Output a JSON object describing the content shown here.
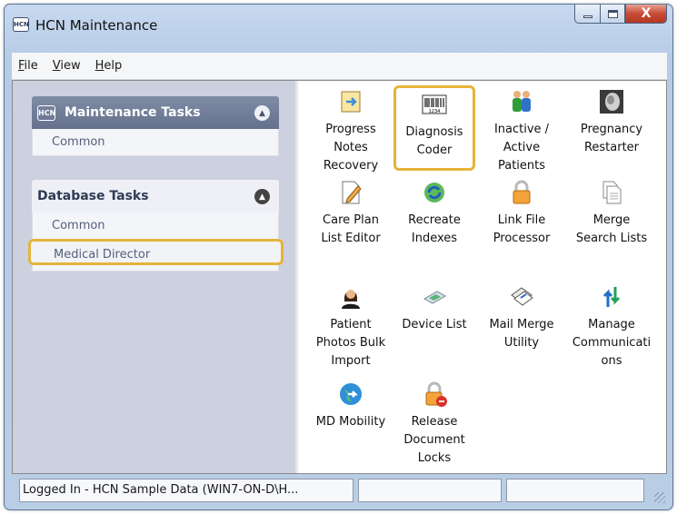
{
  "window": {
    "title": "HCN Maintenance",
    "app_icon_text": "HCN"
  },
  "caption_buttons": {
    "close_glyph": "X"
  },
  "menu": [
    {
      "label": "File",
      "accel": "F",
      "rest": "ile"
    },
    {
      "label": "View",
      "accel": "V",
      "rest": "iew"
    },
    {
      "label": "Help",
      "accel": "H",
      "rest": "elp"
    }
  ],
  "maintenance_panel": {
    "title": "Maintenance Tasks",
    "icon_text": "HCN",
    "items": [
      "Common"
    ]
  },
  "database_panel": {
    "title": "Database Tasks",
    "items": [
      "Common",
      "Medical Director"
    ],
    "highlighted_item": "Medical Director"
  },
  "tools": [
    {
      "label": "Progress Notes Recovery",
      "icon": "notes-recovery-icon",
      "lines": [
        "Progress",
        "Notes",
        "Recovery"
      ]
    },
    {
      "label": "Diagnosis Coder",
      "icon": "barcode-icon",
      "lines": [
        "Diagnosis",
        "Coder"
      ],
      "highlighted": true,
      "icon_text": "1234"
    },
    {
      "label": "Inactive / Active Patients",
      "icon": "patients-icon",
      "lines": [
        "Inactive /",
        "Active",
        "Patients"
      ]
    },
    {
      "label": "Pregnancy Restarter",
      "icon": "ultrasound-icon",
      "lines": [
        "Pregnancy",
        "Restarter"
      ]
    },
    {
      "label": "Care Plan List Editor",
      "icon": "edit-document-icon",
      "lines": [
        "Care Plan",
        "List Editor"
      ]
    },
    {
      "label": "Recreate Indexes",
      "icon": "recreate-icon",
      "lines": [
        "Recreate",
        "Indexes"
      ]
    },
    {
      "label": "Link File Processor",
      "icon": "lock-icon",
      "lines": [
        "Link File",
        "Processor"
      ]
    },
    {
      "label": "Merge Search Lists",
      "icon": "documents-icon",
      "lines": [
        "Merge",
        "Search Lists"
      ]
    },
    {
      "label": "Patient Photos Bulk Import",
      "icon": "person-icon",
      "lines": [
        "Patient",
        "Photos Bulk",
        "Import"
      ]
    },
    {
      "label": "Device List",
      "icon": "device-icon",
      "lines": [
        "Device List"
      ]
    },
    {
      "label": "Mail Merge Utility",
      "icon": "mail-merge-icon",
      "lines": [
        "Mail Merge",
        "Utility"
      ]
    },
    {
      "label": "Manage Communications",
      "icon": "arrows-icon",
      "lines": [
        "Manage",
        "Communicati",
        "ons"
      ]
    },
    {
      "label": "MD Mobility",
      "icon": "globe-icon",
      "lines": [
        "MD Mobility"
      ]
    },
    {
      "label": "Release Document Locks",
      "icon": "lock-remove-icon",
      "lines": [
        "Release",
        "Document",
        "Locks"
      ]
    }
  ],
  "statusbar": {
    "text": "Logged In - HCN Sample Data (WIN7-ON-D\\H...",
    "cell2": "",
    "cell3": ""
  },
  "colors": {
    "highlight": "#e5b43a",
    "panel_header_dark": "#6f7c97",
    "left_pane_bg": "#cdd0df",
    "window_frame": "#b9cde5"
  }
}
